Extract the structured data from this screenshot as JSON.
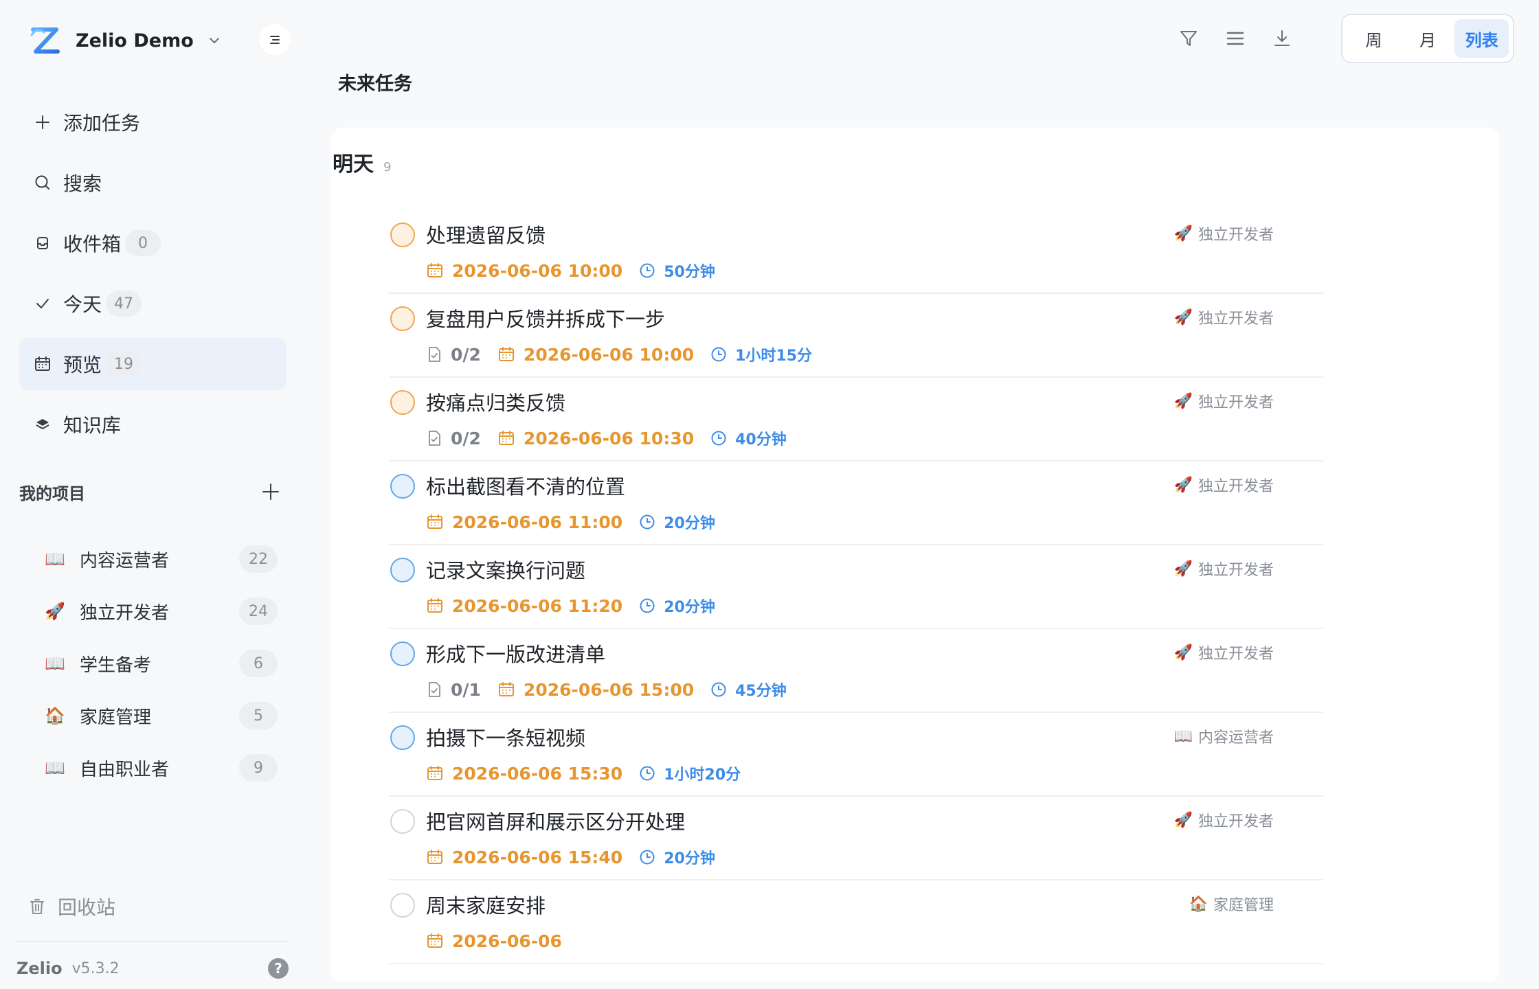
{
  "workspace": {
    "name": "Zelio Demo"
  },
  "nav": [
    {
      "label": "添加任务",
      "icon": "plus-icon"
    },
    {
      "label": "搜索",
      "icon": "search-icon"
    },
    {
      "label": "收件箱",
      "icon": "inbox-icon",
      "count": "0"
    },
    {
      "label": "今天",
      "icon": "check-icon",
      "count": "47"
    },
    {
      "label": "预览",
      "icon": "calendar-icon",
      "count": "19",
      "active": true
    },
    {
      "label": "知识库",
      "icon": "layers-icon"
    }
  ],
  "projects": {
    "title": "我的项目",
    "items": [
      {
        "emoji": "📖",
        "name": "内容运营者",
        "count": "22"
      },
      {
        "emoji": "🚀",
        "name": "独立开发者",
        "count": "24"
      },
      {
        "emoji": "📖",
        "name": "学生备考",
        "count": "6"
      },
      {
        "emoji": "🏠",
        "name": "家庭管理",
        "count": "5"
      },
      {
        "emoji": "📖",
        "name": "自由职业者",
        "count": "9"
      }
    ]
  },
  "trash_label": "回收站",
  "footer": {
    "app": "Zelio",
    "version": "v5.3.2",
    "help": "?"
  },
  "views": {
    "week": "周",
    "month": "月",
    "list": "列表",
    "active": "list"
  },
  "page_title": "未来任务",
  "group": {
    "title": "明天",
    "count": "9"
  },
  "tasks": [
    {
      "title": "处理遗留反馈",
      "status": "orange",
      "project": "独立开发者",
      "project_emoji": "🚀",
      "subtasks": "",
      "date": "2026-06-06 10:00",
      "duration": "50分钟"
    },
    {
      "title": "复盘用户反馈并拆成下一步",
      "status": "orange",
      "project": "独立开发者",
      "project_emoji": "🚀",
      "subtasks": "0/2",
      "date": "2026-06-06 10:00",
      "duration": "1小时15分"
    },
    {
      "title": "按痛点归类反馈",
      "status": "orange",
      "project": "独立开发者",
      "project_emoji": "🚀",
      "subtasks": "0/2",
      "date": "2026-06-06 10:30",
      "duration": "40分钟"
    },
    {
      "title": "标出截图看不清的位置",
      "status": "blue",
      "project": "独立开发者",
      "project_emoji": "🚀",
      "subtasks": "",
      "date": "2026-06-06 11:00",
      "duration": "20分钟"
    },
    {
      "title": "记录文案换行问题",
      "status": "blue",
      "project": "独立开发者",
      "project_emoji": "🚀",
      "subtasks": "",
      "date": "2026-06-06 11:20",
      "duration": "20分钟"
    },
    {
      "title": "形成下一版改进清单",
      "status": "blue",
      "project": "独立开发者",
      "project_emoji": "🚀",
      "subtasks": "0/1",
      "date": "2026-06-06 15:00",
      "duration": "45分钟"
    },
    {
      "title": "拍摄下一条短视频",
      "status": "blue",
      "project": "内容运营者",
      "project_emoji": "📖",
      "subtasks": "",
      "date": "2026-06-06 15:30",
      "duration": "1小时20分"
    },
    {
      "title": "把官网首屏和展示区分开处理",
      "status": "none",
      "project": "独立开发者",
      "project_emoji": "🚀",
      "subtasks": "",
      "date": "2026-06-06 15:40",
      "duration": "20分钟"
    },
    {
      "title": "周末家庭安排",
      "status": "none",
      "project": "家庭管理",
      "project_emoji": "🏠",
      "subtasks": "",
      "date": "2026-06-06",
      "duration": ""
    }
  ],
  "colors": {
    "accent": "#2f80ed",
    "date": "#e7962f",
    "duration": "#3d8ce8",
    "sidebar_bg": "#f7f8fa",
    "active_bg": "#eaf1fb"
  }
}
